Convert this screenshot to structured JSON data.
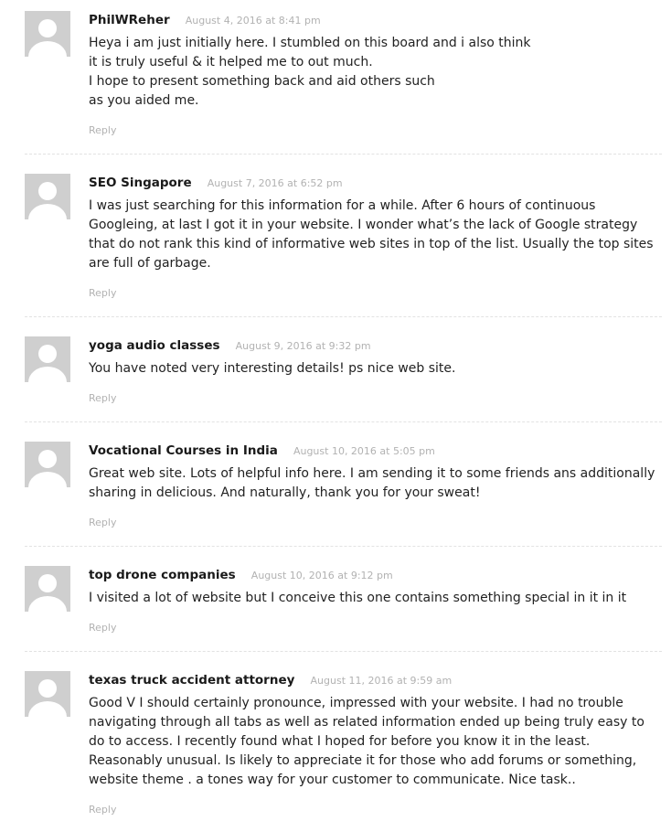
{
  "comments": [
    {
      "author": "PhilWReher",
      "date": "August 4, 2016 at 8:41 pm",
      "lines": [
        "Heya i am just initially here. I stumbled on this board and i also think",
        "it is truly useful & it helped me to out much.",
        "I hope to present something back and aid others such",
        "as you aided me."
      ],
      "reply": "Reply"
    },
    {
      "author": "SEO Singapore",
      "date": "August 7, 2016 at 6:52 pm",
      "lines": [
        "I was just searching for this information for a while. After 6 hours of continuous",
        "Googleing, at last I got it in your website. I wonder what’s the lack of Google strategy",
        "that do not rank this kind of informative web sites in top of the list. Usually the top sites",
        "are full of garbage."
      ],
      "reply": "Reply"
    },
    {
      "author": "yoga audio classes",
      "date": "August 9, 2016 at 9:32 pm",
      "lines": [
        "You have noted very interesting details! ps nice web site."
      ],
      "reply": "Reply"
    },
    {
      "author": "Vocational Courses in India",
      "date": "August 10, 2016 at 5:05 pm",
      "lines": [
        "Great web site. Lots of helpful info here. I am sending it to some friends ans additionally",
        "sharing in delicious. And naturally, thank you for your sweat!"
      ],
      "reply": "Reply"
    },
    {
      "author": "top drone companies",
      "date": "August 10, 2016 at 9:12 pm",
      "lines": [
        "I visited a lot of website but I conceive this one contains something special in it in it"
      ],
      "reply": "Reply"
    },
    {
      "author": "texas truck accident attorney",
      "date": "August 11, 2016 at 9:59 am",
      "lines": [
        "Good V I should certainly pronounce, impressed with your website. I had no trouble",
        "navigating through all tabs as well as related information ended up being truly easy to",
        "do to access. I recently found what I hoped for before you know it in the least.",
        "Reasonably unusual. Is likely to appreciate it for those who add forums or something,",
        "website theme . a tones way for your customer to communicate. Nice task.."
      ],
      "reply": "Reply"
    }
  ]
}
